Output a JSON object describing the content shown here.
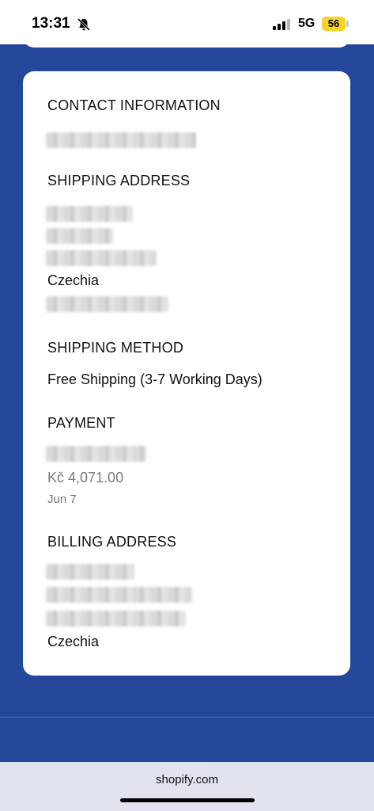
{
  "status_bar": {
    "time": "13:31",
    "network": "5G",
    "battery": "56",
    "icons": [
      "bell-slash-icon",
      "cellular-signal-icon",
      "battery-icon"
    ]
  },
  "order": {
    "contact": {
      "title": "CONTACT INFORMATION"
    },
    "shipping_address": {
      "title": "SHIPPING ADDRESS",
      "country": "Czechia"
    },
    "shipping_method": {
      "title": "SHIPPING METHOD",
      "value": "Free Shipping (3-7 Working Days)"
    },
    "payment": {
      "title": "PAYMENT",
      "amount": "Kč 4,071.00",
      "date": "Jun 7"
    },
    "billing_address": {
      "title": "BILLING ADDRESS",
      "country": "Czechia"
    }
  },
  "browser": {
    "domain": "shopify.com"
  },
  "colors": {
    "background": "#25479a",
    "card": "#ffffff",
    "bottom_bar": "#e1e3ef"
  }
}
